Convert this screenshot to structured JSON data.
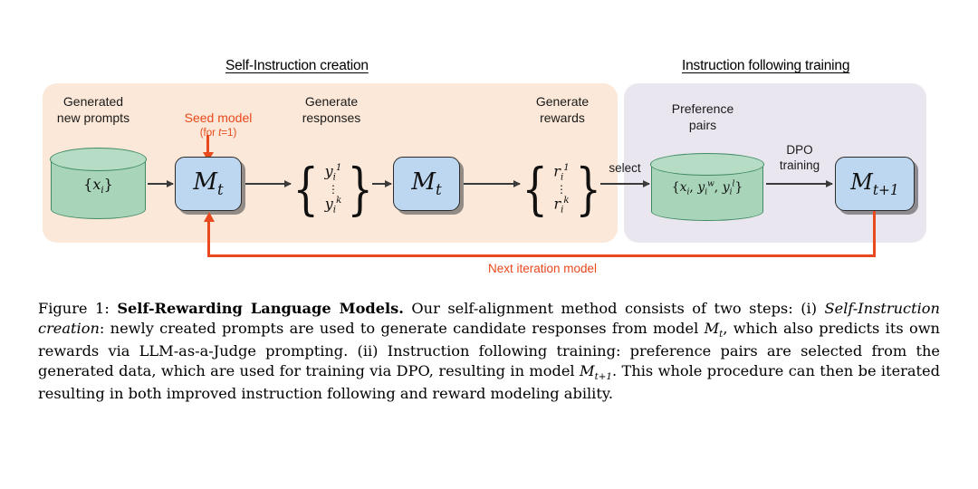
{
  "figure": {
    "panels": {
      "left_title": "Self-Instruction creation",
      "right_title": "Instruction following training"
    },
    "labels": {
      "generated_new_prompts": "Generated\nnew prompts",
      "seed_model": "Seed model",
      "seed_model_sub_prefix": "(for ",
      "seed_model_sub_var": "t",
      "seed_model_sub_suffix": "=1)",
      "generate_responses": "Generate\nresponses",
      "generate_rewards": "Generate\nrewards",
      "preference_pairs": "Preference\npairs",
      "select": "select",
      "dpo_training": "DPO\ntraining",
      "next_iteration_model": "Next iteration model"
    },
    "nodes": {
      "prompts_set": "{x_i}",
      "model_t_1": "M_t",
      "model_t_2": "M_t",
      "model_t_plus_1": "M_t+1",
      "responses_top": "y_i^1",
      "responses_dots": "⋮",
      "responses_bottom": "y_i^k",
      "rewards_top": "r_i^1",
      "rewards_dots": "⋮",
      "rewards_bottom": "r_i^k",
      "preference_pairs_set": "{x_i, y_i^w, y_i^l}"
    },
    "colors": {
      "left_panel_bg": "#fbe8d8",
      "right_panel_bg": "#eae6ef",
      "model_box_fill": "#bdd7f0",
      "model_box_border": "#2b2b2b",
      "cylinder_fill": "#a8d5ba",
      "cylinder_border": "#3f8a63",
      "accent_red": "#e8491d",
      "arrow_gray": "#3a3a3a"
    }
  },
  "caption": {
    "figure_number": "Figure 1:",
    "title": "Self-Rewarding Language Models.",
    "body_1": " Our self-alignment method consists of two steps: (i) ",
    "step_one_italic": "Self-Instruction creation",
    "body_2": ": newly created prompts are used to generate candidate responses from model ",
    "model_t": "M_t",
    "body_3": ", which also predicts its own rewards via LLM-as-a-Judge prompting. (ii) Instruction following training: preference pairs are selected from the generated data, which are used for training via DPO, resulting in model ",
    "model_t_plus_1": "M_t+1",
    "body_4": ". This whole procedure can then be iterated resulting in both improved instruction following and reward modeling ability."
  }
}
